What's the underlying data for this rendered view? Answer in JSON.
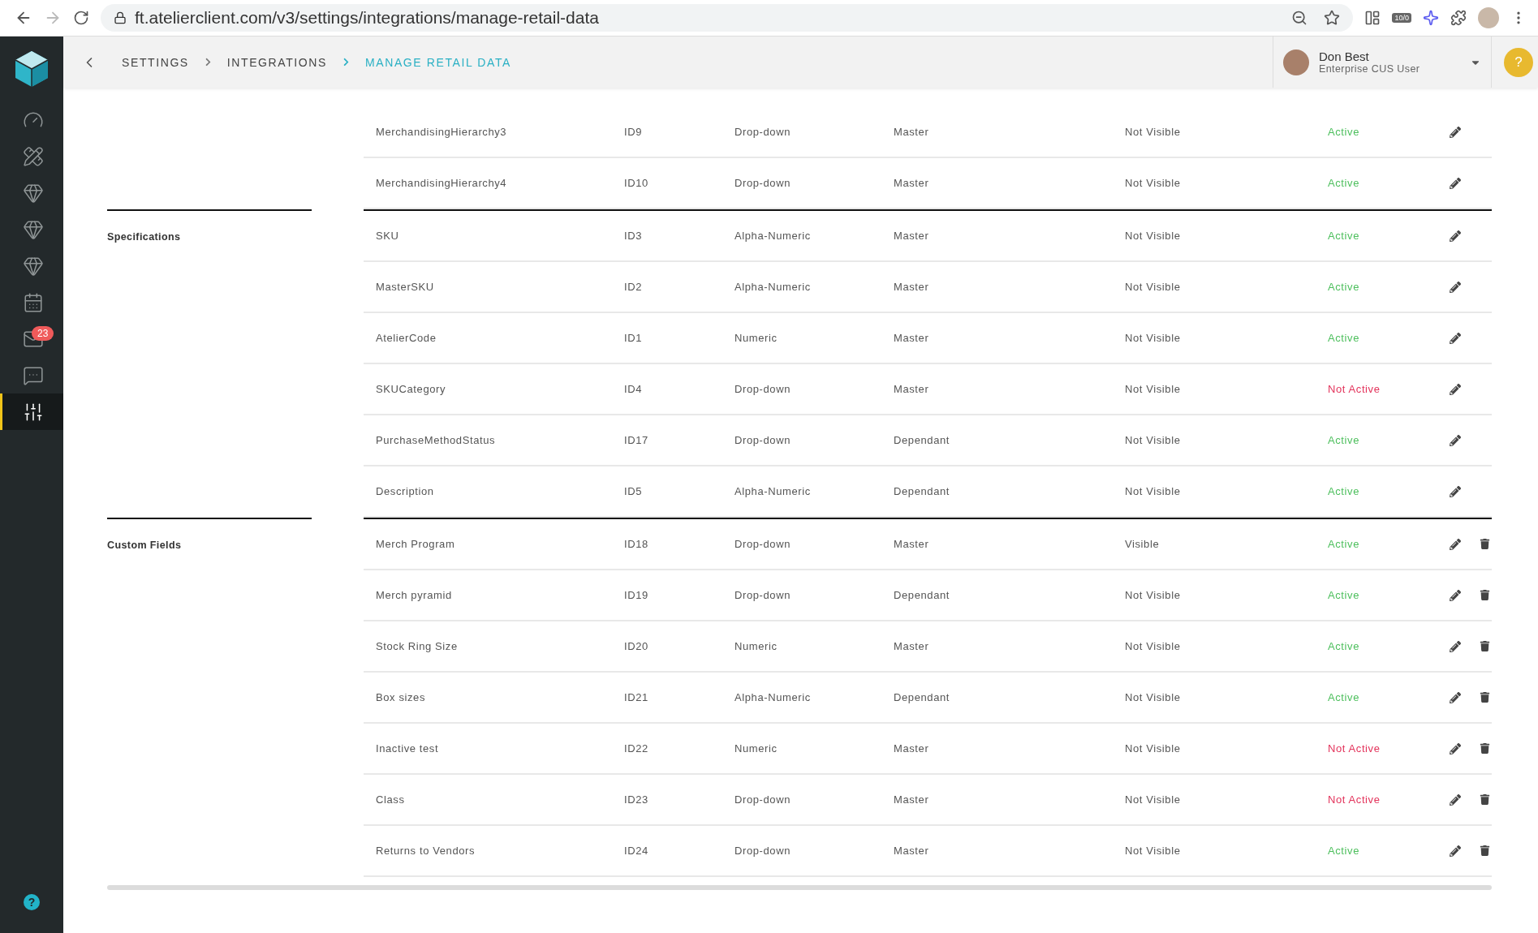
{
  "browser": {
    "url": "ft.atelierclient.com/v3/settings/integrations/manage-retail-data",
    "extension_badge": "10/0"
  },
  "header": {
    "breadcrumbs": [
      {
        "label": "SETTINGS",
        "selected": false
      },
      {
        "label": "INTEGRATIONS",
        "selected": false
      },
      {
        "label": "MANAGE RETAIL DATA",
        "selected": true
      }
    ],
    "user": {
      "name": "Don Best",
      "role": "Enterprise CUS User"
    },
    "help": "?"
  },
  "sidebar": {
    "items": [
      {
        "selected": false
      },
      {
        "selected": false
      },
      {
        "selected": false
      },
      {
        "selected": false
      },
      {
        "selected": false
      },
      {
        "selected": false
      },
      {
        "selected": false,
        "badge": "23"
      },
      {
        "selected": false
      },
      {
        "selected": true
      }
    ],
    "help": "?"
  },
  "groups": [
    {
      "rows": [
        {
          "name": "MerchandisingHierarchy3",
          "id": "ID9",
          "type": "Drop-down",
          "role": "Master",
          "visibility": "Not Visible",
          "status": "Active",
          "active": true,
          "deletable": false
        },
        {
          "name": "MerchandisingHierarchy4",
          "id": "ID10",
          "type": "Drop-down",
          "role": "Master",
          "visibility": "Not Visible",
          "status": "Active",
          "active": true,
          "deletable": false
        }
      ]
    },
    {
      "title": "Specifications",
      "rows": [
        {
          "name": "SKU",
          "id": "ID3",
          "type": "Alpha-Numeric",
          "role": "Master",
          "visibility": "Not Visible",
          "status": "Active",
          "active": true,
          "deletable": false
        },
        {
          "name": "MasterSKU",
          "id": "ID2",
          "type": "Alpha-Numeric",
          "role": "Master",
          "visibility": "Not Visible",
          "status": "Active",
          "active": true,
          "deletable": false
        },
        {
          "name": "AtelierCode",
          "id": "ID1",
          "type": "Numeric",
          "role": "Master",
          "visibility": "Not Visible",
          "status": "Active",
          "active": true,
          "deletable": false
        },
        {
          "name": "SKUCategory",
          "id": "ID4",
          "type": "Drop-down",
          "role": "Master",
          "visibility": "Not Visible",
          "status": "Not Active",
          "active": false,
          "deletable": false
        },
        {
          "name": "PurchaseMethodStatus",
          "id": "ID17",
          "type": "Drop-down",
          "role": "Dependant",
          "visibility": "Not Visible",
          "status": "Active",
          "active": true,
          "deletable": false
        },
        {
          "name": "Description",
          "id": "ID5",
          "type": "Alpha-Numeric",
          "role": "Dependant",
          "visibility": "Not Visible",
          "status": "Active",
          "active": true,
          "deletable": false
        }
      ]
    },
    {
      "title": "Custom Fields",
      "rows": [
        {
          "name": "Merch Program",
          "id": "ID18",
          "type": "Drop-down",
          "role": "Master",
          "visibility": "Visible",
          "status": "Active",
          "active": true,
          "deletable": true
        },
        {
          "name": "Merch pyramid",
          "id": "ID19",
          "type": "Drop-down",
          "role": "Dependant",
          "visibility": "Not Visible",
          "status": "Active",
          "active": true,
          "deletable": true
        },
        {
          "name": "Stock Ring Size",
          "id": "ID20",
          "type": "Numeric",
          "role": "Master",
          "visibility": "Not Visible",
          "status": "Active",
          "active": true,
          "deletable": true
        },
        {
          "name": "Box sizes",
          "id": "ID21",
          "type": "Alpha-Numeric",
          "role": "Dependant",
          "visibility": "Not Visible",
          "status": "Active",
          "active": true,
          "deletable": true
        },
        {
          "name": "Inactive test",
          "id": "ID22",
          "type": "Numeric",
          "role": "Master",
          "visibility": "Not Visible",
          "status": "Not Active",
          "active": false,
          "deletable": true
        },
        {
          "name": "Class",
          "id": "ID23",
          "type": "Drop-down",
          "role": "Master",
          "visibility": "Not Visible",
          "status": "Not Active",
          "active": false,
          "deletable": true
        },
        {
          "name": "Returns to Vendors",
          "id": "ID24",
          "type": "Drop-down",
          "role": "Master",
          "visibility": "Not Visible",
          "status": "Active",
          "active": true,
          "deletable": true
        }
      ]
    }
  ]
}
